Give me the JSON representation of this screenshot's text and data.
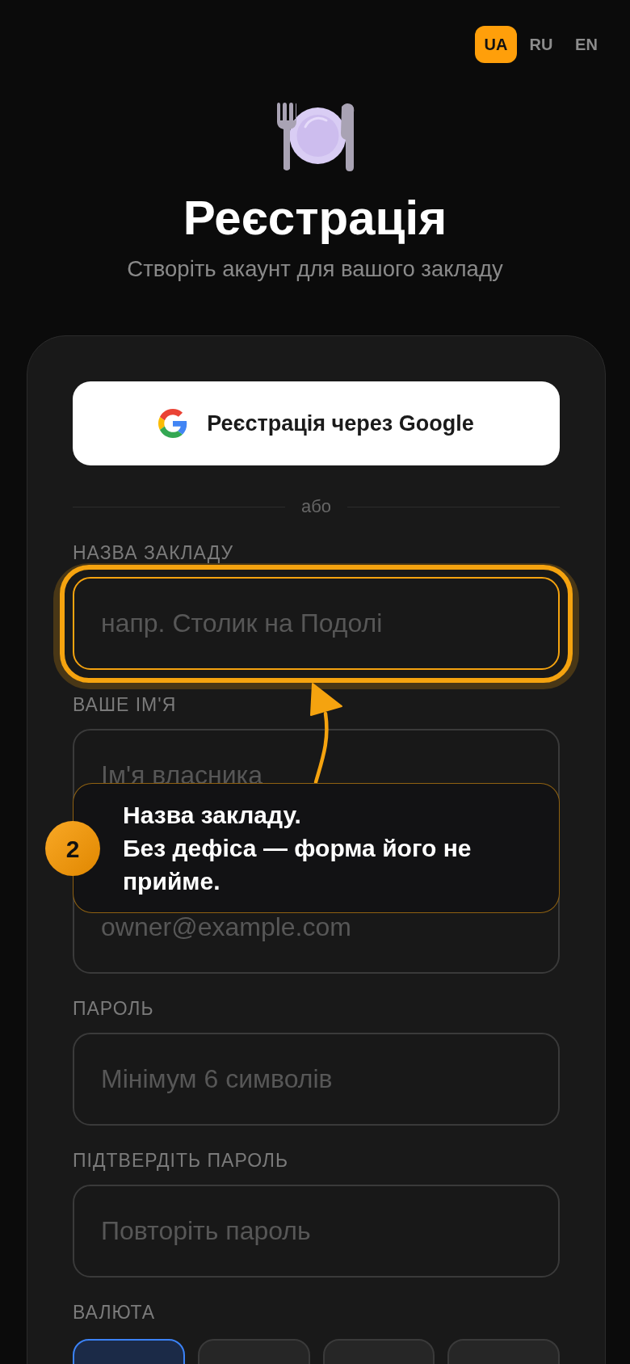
{
  "language_switcher": [
    {
      "label": "UA",
      "selected": true
    },
    {
      "label": "RU",
      "selected": false
    },
    {
      "label": "EN",
      "selected": false
    }
  ],
  "header": {
    "title": "Реєстрація",
    "subtitle": "Створіть акаунт для вашого закладу"
  },
  "google_button": {
    "label": "Реєстрація через Google"
  },
  "divider": {
    "label": "або"
  },
  "fields": [
    {
      "label": "НАЗВА ЗАКЛАДУ",
      "placeholder": "напр. Столик на Подолі",
      "highlighted": true
    },
    {
      "label": "ВАШЕ ІМ'Я",
      "placeholder": "Ім'я власника",
      "highlighted": false
    },
    {
      "placeholder": "owner@example.com",
      "highlighted": false
    },
    {
      "label": "ПАРОЛЬ",
      "placeholder": "Мінімум 6 символів",
      "highlighted": false
    },
    {
      "label": "ПІДТВЕРДІТЬ ПАРОЛЬ",
      "placeholder": "Повторіть пароль",
      "highlighted": false
    }
  ],
  "currency": {
    "label": "ВАЛЮТА",
    "options": [
      {
        "selected": true
      },
      {
        "selected": false
      },
      {
        "selected": false
      },
      {
        "selected": false
      }
    ]
  },
  "tour_tip": {
    "step": "2",
    "text": "Назва закладу.\nБез дефіса — форма його не прийме."
  }
}
